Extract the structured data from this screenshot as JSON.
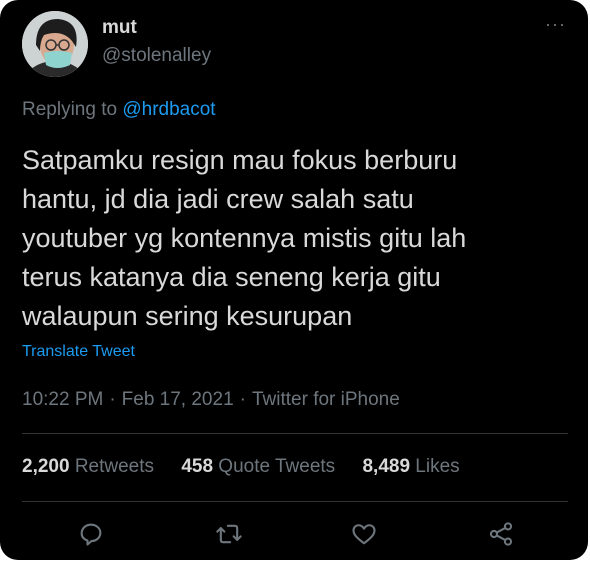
{
  "author": {
    "display_name": "mut",
    "handle": "@stolenalley",
    "avatar_icon": "profile-photo-masked-person"
  },
  "more_icon": "more-horizontal-icon",
  "more_label": "···",
  "replying": {
    "prefix": "Replying to ",
    "target": "@hrdbacot"
  },
  "tweet": {
    "lines": [
      "Satpamku resign mau fokus berburu",
      "hantu, jd dia jadi crew salah satu",
      "youtuber yg kontennya mistis gitu lah",
      "terus katanya dia seneng kerja gitu",
      "walaupun sering kesurupan"
    ],
    "translate_label": "Translate Tweet",
    "time": "10:22 PM",
    "date": "Feb 17, 2021",
    "source": "Twitter for iPhone",
    "separator": "·"
  },
  "stats": {
    "retweets_count": "2,200",
    "retweets_label": "Retweets",
    "quotes_count": "458",
    "quotes_label": "Quote Tweets",
    "likes_count": "8,489",
    "likes_label": "Likes"
  },
  "actions": [
    "reply-icon",
    "retweet-icon",
    "like-icon",
    "share-icon"
  ],
  "colors": {
    "background": "#000000",
    "text": "#d9d9d9",
    "muted": "#6e767d",
    "link": "#1d9bf0",
    "divider": "#2f3336"
  }
}
